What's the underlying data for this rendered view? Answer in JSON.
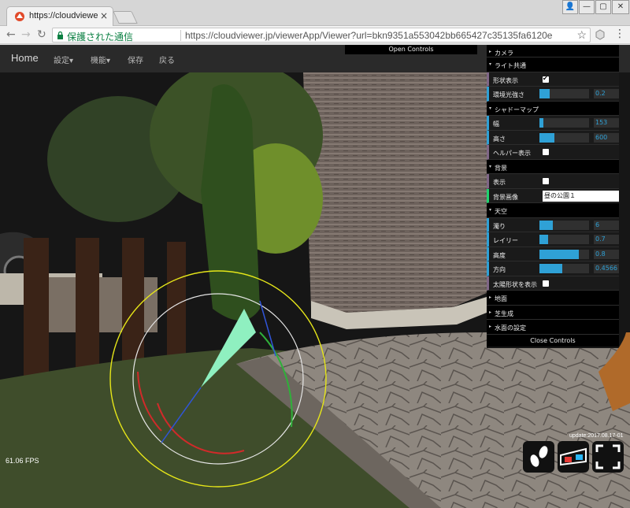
{
  "browser": {
    "tab_title": "https://cloudviewer.jp",
    "tab_close": "×",
    "secure_label": "保護された通信",
    "url": "https://cloudviewer.jp/viewerApp/Viewer?url=bkn9351a553042bb665427c35135fa6120e",
    "window_buttons": [
      "👤",
      "—",
      "▢",
      "✕"
    ]
  },
  "app": {
    "brand": "Home",
    "menu": [
      "設定▾",
      "機能▾",
      "保存",
      "戻る"
    ],
    "open_controls": "Open Controls",
    "close_controls": "Close Controls"
  },
  "gui": {
    "camera": "カメラ",
    "light_folder": "ライト共通",
    "shape_display": "形状表示",
    "env_light": "環境光強さ",
    "env_light_value": "0.2",
    "env_light_fraction": 0.2,
    "shadow_folder": "シャドーマップ",
    "width_label": "幅",
    "width_value": "153",
    "width_fraction": 0.08,
    "height_label": "高さ",
    "height_value": "600",
    "height_fraction": 0.3,
    "helper_label": "ヘルパー表示",
    "background_folder": "背景",
    "bg_display": "表示",
    "bg_image": "背景画像",
    "bg_image_value": "昼の公園１",
    "sky_folder": "天空",
    "turbidity": "濁り",
    "turbidity_value": "6",
    "turbidity_fraction": 0.27,
    "rayleigh": "レイリー",
    "rayleigh_value": "0.7",
    "rayleigh_fraction": 0.17,
    "altitude": "高度",
    "altitude_value": "0.8",
    "altitude_fraction": 0.8,
    "direction": "方向",
    "direction_value": "0.4566",
    "direction_fraction": 0.46,
    "sun_shape": "太陽形状を表示",
    "ground": "地面",
    "vegetation": "芝生成",
    "water": "水面の設定"
  },
  "status": {
    "update": "update:2017.08.17-01",
    "fps": "61.06 FPS"
  },
  "colors": {
    "gui_blue": "#2fa1d6",
    "secure_green": "#0b8043",
    "gizmo_yellow": "#e6e619",
    "gizmo_red": "#d12a2a",
    "gizmo_green": "#2fb03a",
    "gizmo_blue": "#3055d8",
    "gizmo_cone": "#8ff0c0"
  },
  "icons": {
    "footprint": "footprint-icon",
    "vr_glasses": "3d-glasses-icon",
    "fullscreen": "fullscreen-icon"
  }
}
